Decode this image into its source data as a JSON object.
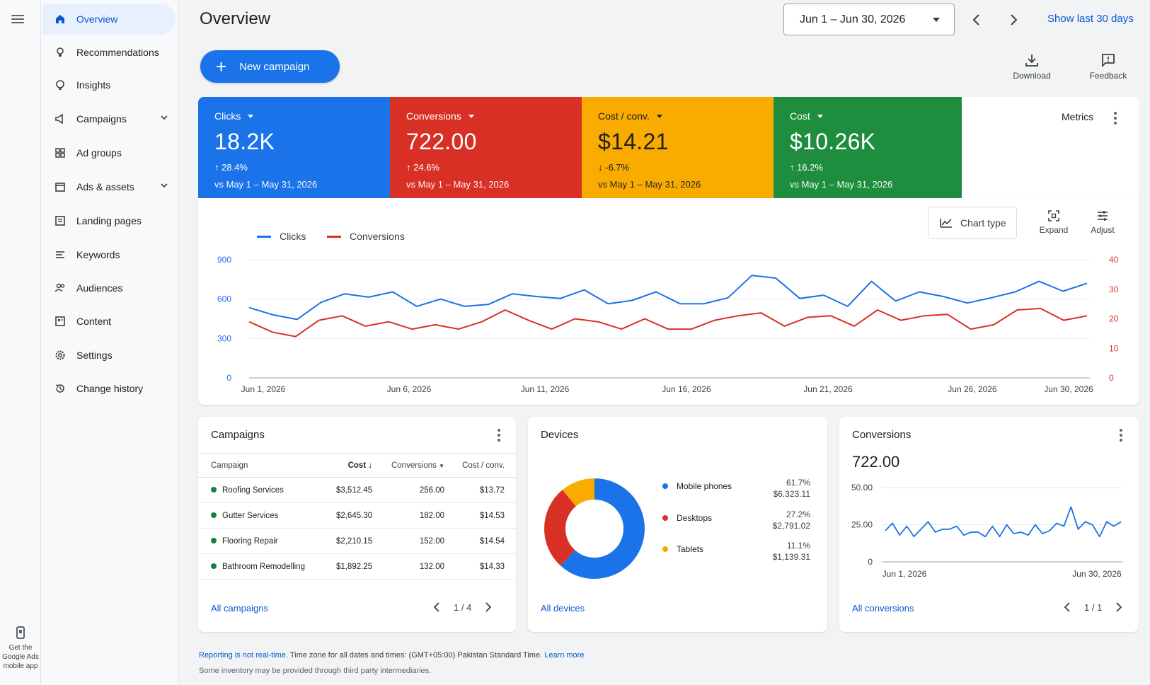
{
  "rail": {
    "app_label_1": "Get the",
    "app_label_2": "Google Ads",
    "app_label_3": "mobile app"
  },
  "sidebar": {
    "items": [
      {
        "label": "Overview",
        "icon": "home-icon",
        "active": true
      },
      {
        "label": "Recommendations",
        "icon": "lightbulb-icon"
      },
      {
        "label": "Insights",
        "icon": "insights-icon"
      },
      {
        "label": "Campaigns",
        "icon": "megaphone-icon",
        "expandable": true
      },
      {
        "label": "Ad groups",
        "icon": "grid-icon"
      },
      {
        "label": "Ads & assets",
        "icon": "ads-icon",
        "expandable": true
      },
      {
        "label": "Landing pages",
        "icon": "page-icon"
      },
      {
        "label": "Keywords",
        "icon": "keywords-icon"
      },
      {
        "label": "Audiences",
        "icon": "people-icon"
      },
      {
        "label": "Content",
        "icon": "content-icon"
      },
      {
        "label": "Settings",
        "icon": "gear-icon"
      },
      {
        "label": "Change history",
        "icon": "history-icon"
      }
    ]
  },
  "header": {
    "title": "Overview",
    "date_range": "Jun 1 – Jun 30, 2026",
    "show_last": "Show last 30 days",
    "new_campaign": "New campaign",
    "download": "Download",
    "feedback": "Feedback"
  },
  "tiles": [
    {
      "name": "Clicks",
      "value": "18.2K",
      "change": "28.4%",
      "direction": "up",
      "compare": "vs May 1 – May 31, 2026",
      "color": "#1a73e8"
    },
    {
      "name": "Conversions",
      "value": "722.00",
      "change": "24.6%",
      "direction": "up",
      "compare": "vs May 1 – May 31, 2026",
      "color": "#d93025"
    },
    {
      "name": "Cost / conv.",
      "value": "$14.21",
      "change": "-6.7%",
      "direction": "down",
      "compare": "vs May 1 – May 31, 2026",
      "color": "#f9ab00"
    },
    {
      "name": "Cost",
      "value": "$10.26K",
      "change": "16.2%",
      "direction": "up",
      "compare": "vs May 1 – May 31, 2026",
      "color": "#1e8e3e"
    }
  ],
  "metrics_label": "Metrics",
  "chart_tools": {
    "chart_type": "Chart type",
    "expand": "Expand",
    "adjust": "Adjust"
  },
  "chart_data": {
    "type": "line",
    "x_labels": [
      "Jun 1, 2026",
      "Jun 6, 2026",
      "Jun 11, 2026",
      "Jun 16, 2026",
      "Jun 21, 2026",
      "Jun 26, 2026",
      "Jun 30, 2026"
    ],
    "y_left": {
      "ticks": [
        0,
        300,
        600,
        900
      ],
      "range": [
        0,
        900
      ]
    },
    "y_right": {
      "ticks": [
        0,
        10,
        20,
        30,
        40
      ],
      "range": [
        0,
        40
      ]
    },
    "series": [
      {
        "name": "Clicks",
        "axis": "left",
        "color": "#1a73e8",
        "values": [
          535,
          480,
          445,
          575,
          640,
          615,
          655,
          545,
          600,
          545,
          560,
          640,
          620,
          605,
          670,
          565,
          590,
          655,
          565,
          565,
          610,
          780,
          760,
          605,
          630,
          545,
          735,
          585,
          655,
          620,
          570,
          610,
          655,
          735,
          660,
          720
        ]
      },
      {
        "name": "Conversions",
        "axis": "right",
        "color": "#d93025",
        "values": [
          19,
          15.5,
          14,
          19.5,
          21,
          17.5,
          19,
          16.5,
          18,
          16.5,
          19,
          23,
          19.5,
          16.5,
          20,
          19,
          16.5,
          20,
          16.5,
          16.5,
          19.5,
          21,
          22,
          17.5,
          20.5,
          21,
          17.5,
          23,
          19.5,
          21,
          21.5,
          16.5,
          18,
          23,
          23.5,
          19.5,
          21
        ]
      }
    ]
  },
  "campaigns": {
    "title": "Campaigns",
    "headers": [
      "Campaign",
      "Cost",
      "Conversions",
      "Cost / conv."
    ],
    "rows": [
      [
        "Roofing Services",
        "$3,512.45",
        "256.00",
        "$13.72"
      ],
      [
        "Gutter Services",
        "$2,645.30",
        "182.00",
        "$14.53"
      ],
      [
        "Flooring Repair",
        "$2,210.15",
        "152.00",
        "$14.54"
      ],
      [
        "Bathroom Remodelling",
        "$1,892.25",
        "132.00",
        "$14.33"
      ]
    ],
    "link": "All campaigns",
    "page": "1 / 4"
  },
  "devices": {
    "title": "Devices",
    "items": [
      {
        "name": "Mobile phones",
        "pct": "61.7%",
        "amount": "$6,323.11",
        "value": 61.7,
        "color": "#1a73e8"
      },
      {
        "name": "Desktops",
        "pct": "27.2%",
        "amount": "$2,791.02",
        "value": 27.2,
        "color": "#d93025"
      },
      {
        "name": "Tablets",
        "pct": "11.1%",
        "amount": "$1,139.31",
        "value": 11.1,
        "color": "#f9ab00"
      }
    ],
    "link": "All devices"
  },
  "conversions_card": {
    "title": "Conversions",
    "value": "722.00",
    "y_ticks": [
      "50.00",
      "25.00",
      "0"
    ],
    "x_labels": [
      "Jun 1, 2026",
      "Jun 30, 2026"
    ],
    "values": [
      21,
      26,
      18,
      24,
      17,
      22,
      27,
      20,
      22,
      22,
      24,
      18,
      20,
      20,
      17,
      24,
      17,
      25,
      19,
      20,
      18,
      25,
      19,
      21,
      26,
      24,
      37,
      22,
      27,
      25,
      17,
      27,
      24,
      27
    ],
    "link": "All conversions",
    "page": "1 / 1"
  },
  "footer": {
    "line1_link": "Reporting is not real-time.",
    "line1_text": " Time zone for all dates and times: (GMT+05:00) Pakistan Standard Time. ",
    "line1_link2": "Learn more",
    "line2": "Some inventory may be provided through third party intermediaries."
  }
}
